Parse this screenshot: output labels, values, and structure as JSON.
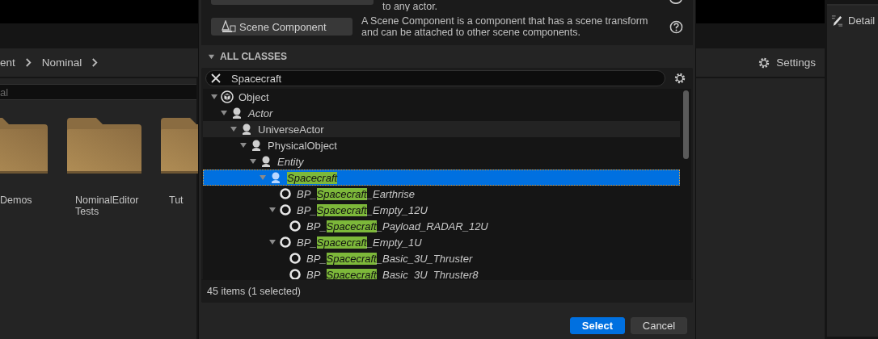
{
  "content_browser": {
    "breadcrumb": [
      "ent",
      "Nominal"
    ],
    "search": {
      "placeholder": "al"
    },
    "folders": [
      {
        "label": "Demos"
      },
      {
        "label": "NominalEditor Tests"
      },
      {
        "label": "Tut"
      }
    ],
    "settings_button": "Settings"
  },
  "details_tab": {
    "label": "Detail"
  },
  "dialog": {
    "top_row": {
      "description": "to any actor."
    },
    "common_classes": [
      {
        "label": "Scene Component",
        "description": "A Scene Component is a component that has a scene transform and can be attached to other scene components."
      }
    ],
    "section": {
      "title": "ALL CLASSES",
      "expanded": true
    },
    "search": {
      "value": "Spacecraft"
    },
    "tree": [
      {
        "kind": "object",
        "abstract": false,
        "hovered": false,
        "selected": false,
        "expanded": true,
        "parts": [
          {
            "text": "Object",
            "match": false
          }
        ],
        "children": [
          {
            "kind": "actor",
            "abstract": true,
            "hovered": false,
            "selected": false,
            "expanded": true,
            "parts": [
              {
                "text": "Actor",
                "match": false
              }
            ],
            "children": [
              {
                "kind": "actor",
                "abstract": false,
                "hovered": true,
                "selected": false,
                "expanded": true,
                "parts": [
                  {
                    "text": "UniverseActor",
                    "match": false
                  }
                ],
                "children": [
                  {
                    "kind": "actor",
                    "abstract": false,
                    "hovered": false,
                    "selected": false,
                    "expanded": true,
                    "parts": [
                      {
                        "text": "PhysicalObject",
                        "match": false
                      }
                    ],
                    "children": [
                      {
                        "kind": "actor",
                        "abstract": true,
                        "hovered": false,
                        "selected": false,
                        "expanded": true,
                        "parts": [
                          {
                            "text": "Entity",
                            "match": false
                          }
                        ],
                        "children": [
                          {
                            "kind": "actor",
                            "abstract": true,
                            "hovered": false,
                            "selected": true,
                            "expanded": true,
                            "parts": [
                              {
                                "text": "Spacecraft",
                                "match": true
                              }
                            ],
                            "children": [
                              {
                                "kind": "blueprint",
                                "abstract": true,
                                "hovered": false,
                                "selected": false,
                                "parts": [
                                  {
                                    "text": "BP_",
                                    "match": false
                                  },
                                  {
                                    "text": "Spacecraft",
                                    "match": true
                                  },
                                  {
                                    "text": "_Earthrise",
                                    "match": false
                                  }
                                ]
                              },
                              {
                                "kind": "blueprint",
                                "abstract": true,
                                "hovered": false,
                                "selected": false,
                                "expanded": true,
                                "parts": [
                                  {
                                    "text": "BP_",
                                    "match": false
                                  },
                                  {
                                    "text": "Spacecraft",
                                    "match": true
                                  },
                                  {
                                    "text": "_Empty_12U",
                                    "match": false
                                  }
                                ],
                                "children": [
                                  {
                                    "kind": "blueprint",
                                    "abstract": true,
                                    "hovered": false,
                                    "selected": false,
                                    "parts": [
                                      {
                                        "text": "BP_",
                                        "match": false
                                      },
                                      {
                                        "text": "Spacecraft",
                                        "match": true
                                      },
                                      {
                                        "text": "_Payload_RADAR_12U",
                                        "match": false
                                      }
                                    ]
                                  }
                                ]
                              },
                              {
                                "kind": "blueprint",
                                "abstract": true,
                                "hovered": false,
                                "selected": false,
                                "expanded": true,
                                "parts": [
                                  {
                                    "text": "BP_",
                                    "match": false
                                  },
                                  {
                                    "text": "Spacecraft",
                                    "match": true
                                  },
                                  {
                                    "text": "_Empty_1U",
                                    "match": false
                                  }
                                ],
                                "children": [
                                  {
                                    "kind": "blueprint",
                                    "abstract": true,
                                    "hovered": false,
                                    "selected": false,
                                    "parts": [
                                      {
                                        "text": "BP_",
                                        "match": false
                                      },
                                      {
                                        "text": "Spacecraft",
                                        "match": true
                                      },
                                      {
                                        "text": "_Basic_3U_Thruster",
                                        "match": false
                                      }
                                    ]
                                  },
                                  {
                                    "kind": "blueprint",
                                    "abstract": true,
                                    "hovered": false,
                                    "selected": false,
                                    "parts": [
                                      {
                                        "text": "BP_",
                                        "match": false
                                      },
                                      {
                                        "text": "Spacecraft",
                                        "match": true
                                      },
                                      {
                                        "text": "_Basic_3U_Thruster8",
                                        "match": false
                                      }
                                    ]
                                  }
                                ]
                              }
                            ]
                          }
                        ]
                      }
                    ]
                  }
                ]
              }
            ]
          }
        ]
      }
    ],
    "status": "45 items (1 selected)",
    "buttons": [
      {
        "label": "Select",
        "kind": "primary"
      },
      {
        "label": "Cancel",
        "kind": "secondary"
      }
    ]
  }
}
